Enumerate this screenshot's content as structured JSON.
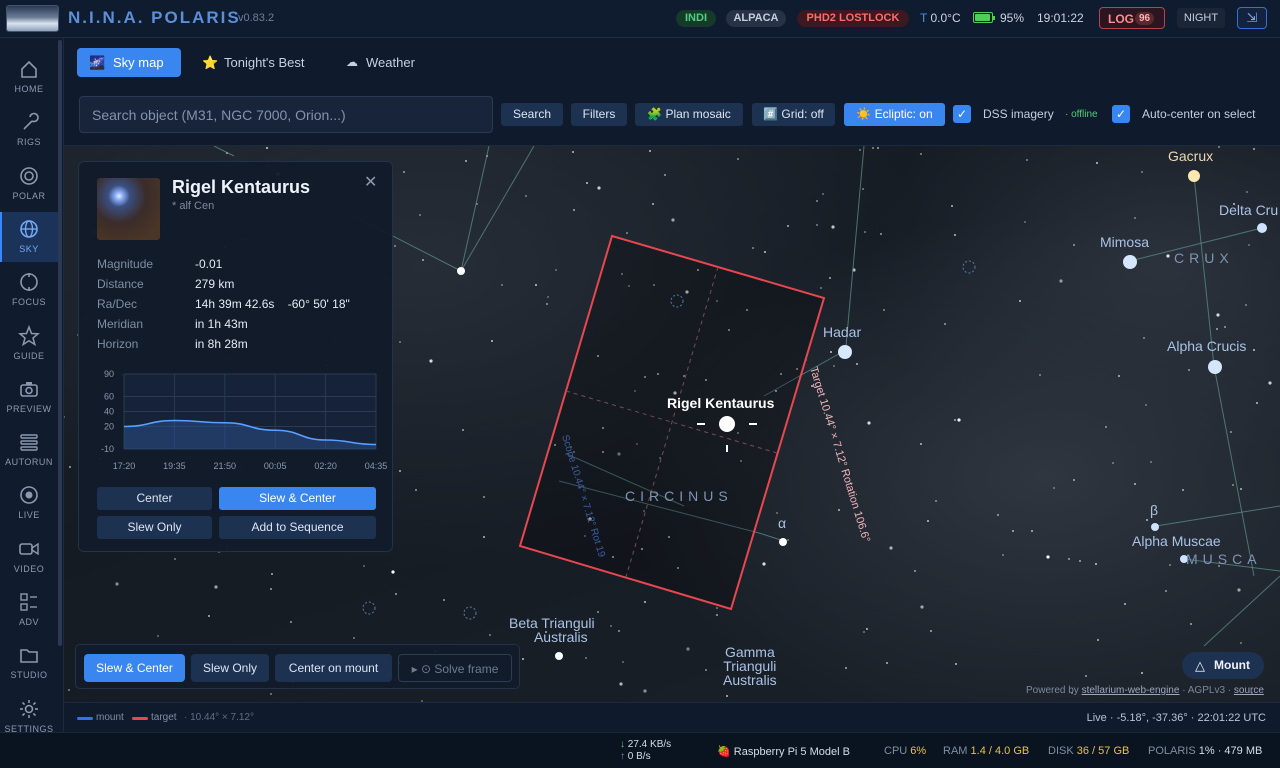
{
  "header": {
    "title": "N.I.N.A. POLARIS",
    "version": "v0.83.2",
    "pills": {
      "indi": "INDI",
      "alpaca": "ALPACA",
      "phd2": "PHD2 LOSTLOCK"
    },
    "temperature_prefix": "T",
    "temperature": "0.0°C",
    "battery": "95%",
    "clock": "19:01:22",
    "log_label": "LOG",
    "log_count": "96",
    "night_label": "NIGHT"
  },
  "sidebar": {
    "items": [
      {
        "label": "HOME",
        "icon": "home-icon"
      },
      {
        "label": "RIGS",
        "icon": "wrench-icon"
      },
      {
        "label": "POLAR",
        "icon": "polar-target-icon"
      },
      {
        "label": "SKY",
        "icon": "globe-icon",
        "active": true
      },
      {
        "label": "FOCUS",
        "icon": "focus-icon"
      },
      {
        "label": "GUIDE",
        "icon": "star-icon"
      },
      {
        "label": "PREVIEW",
        "icon": "camera-icon"
      },
      {
        "label": "AUTORUN",
        "icon": "list-icon"
      },
      {
        "label": "LIVE",
        "icon": "record-icon"
      },
      {
        "label": "VIDEO",
        "icon": "video-icon"
      },
      {
        "label": "ADV",
        "icon": "advanced-icon"
      },
      {
        "label": "STUDIO",
        "icon": "folder-icon"
      },
      {
        "label": "SETTINGS",
        "icon": "settings-icon"
      }
    ]
  },
  "tabs": [
    {
      "label": "Sky map",
      "icon": "🌌",
      "active": true
    },
    {
      "label": "Tonight's Best",
      "icon": "⭐"
    },
    {
      "label": "Weather",
      "icon": "☁"
    }
  ],
  "toolbar": {
    "search_placeholder": "Search object (M31, NGC 7000, Orion...)",
    "search_label": "Search",
    "filters_label": "Filters",
    "mosaic_label": "🧩 Plan mosaic",
    "grid_label": "#️⃣ Grid: off",
    "ecliptic_label": "☀️ Ecliptic: on",
    "dss_label": "DSS imagery",
    "dss_status": "· offline",
    "autocenter_label": "Auto-center on select"
  },
  "object_panel": {
    "name": "Rigel Kentaurus",
    "alias": "* alf Cen",
    "properties": [
      {
        "label": "Magnitude",
        "value": "-0.01"
      },
      {
        "label": "Distance",
        "value": "279 km"
      },
      {
        "label": "Ra/Dec",
        "value": "14h 39m 42.6s    -60° 50' 18\""
      },
      {
        "label": "Meridian",
        "value": "in 1h 43m"
      },
      {
        "label": "Horizon",
        "value": "in 8h 28m"
      }
    ],
    "buttons": {
      "center": "Center",
      "slew_center": "Slew & Center",
      "slew_only": "Slew Only",
      "add_sequence": "Add to Sequence"
    }
  },
  "chart_data": {
    "type": "area",
    "title": "",
    "xlabel": "",
    "ylabel": "",
    "x": [
      "17:20",
      "19:35",
      "21:50",
      "00:05",
      "02:20",
      "04:35"
    ],
    "y_ticks": [
      90,
      60,
      40,
      20,
      -10
    ],
    "ylim": [
      -10,
      90
    ],
    "series": [
      {
        "values": [
          20,
          28,
          25,
          15,
          2,
          -4
        ]
      }
    ]
  },
  "sky": {
    "target": "Rigel Kentaurus",
    "frame_label_right": "Target 10.44° × 7.12° Rotation 106.6°",
    "frame_label_left": "Scope 10.44° × 7.12° Rot 19",
    "stars": {
      "gacrux": "Gacrux",
      "delta_crucis": "Delta Cru",
      "mimosa": "Mimosa",
      "hadar": "Hadar",
      "alpha_crucis": "Alpha Crucis",
      "alpha": "α",
      "beta": "β",
      "alpha_muscae": "Alpha Muscae",
      "beta_tri_1": "Beta Trianguli",
      "beta_tri_2": "Australis",
      "gamma_tri_1": "Gamma",
      "gamma_tri_2": "Trianguli",
      "gamma_tri_3": "Australis"
    },
    "constellations": {
      "crux": "CRUX",
      "circinus": "CIRCINUS",
      "musca": "MUSCA"
    },
    "mount_label": "Mount",
    "powered_by_prefix": "Powered by",
    "powered_by_link": "stellarium-web-engine",
    "license": "· AGPLv3 ·",
    "source_link": "source"
  },
  "action_bar": {
    "slew_center": "Slew & Center",
    "slew_only": "Slew Only",
    "center_mount": "Center on mount",
    "solve_frame": "▸ ⊙ Solve frame"
  },
  "legend": {
    "mount": "mount",
    "target": "target",
    "fov": "· 10.44° × 7.12°",
    "status": "Live · -5.18°, -37.36° · 22:01:22 UTC",
    "colors": {
      "mount": "#3a6ee8",
      "target": "#e8474f"
    }
  },
  "statusbar": {
    "net_down": "27.4 KB/s",
    "net_up": "0 B/s",
    "device": "Raspberry Pi 5 Model B",
    "cpu_label": "CPU",
    "cpu": "6%",
    "ram_label": "RAM",
    "ram": "1.4 / 4.0 GB",
    "disk_label": "DISK",
    "disk": "36 / 57 GB",
    "polaris_label": "POLARIS",
    "polaris": "1% · 479 MB"
  }
}
